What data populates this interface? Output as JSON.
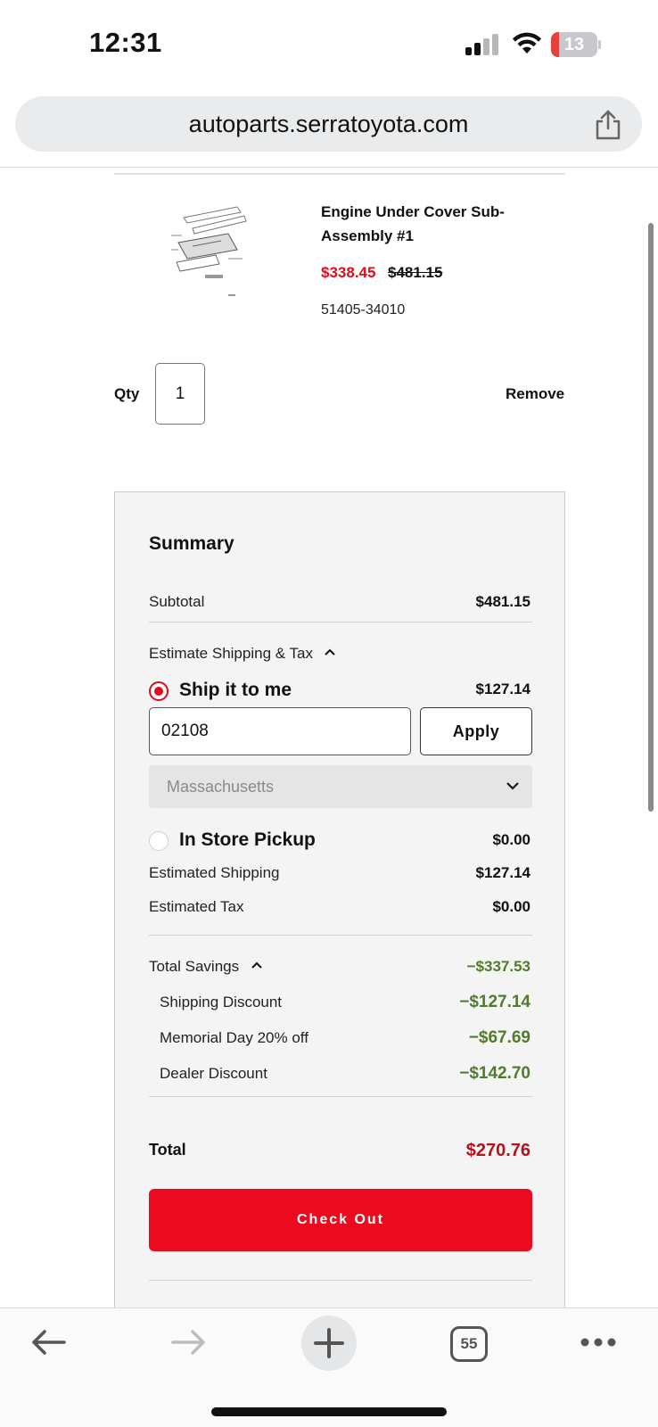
{
  "status_bar": {
    "time": "12:31",
    "battery": "13"
  },
  "browser": {
    "url": "autoparts.serratoyota.com",
    "tab_count": "55"
  },
  "product": {
    "name": "Engine Under Cover Sub-Assembly #1",
    "sale_price": "$338.45",
    "original_price": "$481.15",
    "part_number": "51405-34010",
    "qty_label": "Qty",
    "qty_value": "1",
    "remove_label": "Remove"
  },
  "summary": {
    "title": "Summary",
    "subtotal_label": "Subtotal",
    "subtotal_value": "$481.15",
    "estimate_label": "Estimate Shipping & Tax",
    "ship_option_label": "Ship it to me",
    "ship_option_value": "$127.14",
    "zip_value": "02108",
    "apply_label": "Apply",
    "state_value": "Massachusetts",
    "pickup_label": "In Store Pickup",
    "pickup_value": "$0.00",
    "est_shipping_label": "Estimated Shipping",
    "est_shipping_value": "$127.14",
    "est_tax_label": "Estimated Tax",
    "est_tax_value": "$0.00",
    "savings_label": "Total Savings",
    "savings_value": "−$337.53",
    "discounts": [
      {
        "label": "Shipping Discount",
        "value": "−$127.14"
      },
      {
        "label": "Memorial Day 20% off",
        "value": "−$67.69"
      },
      {
        "label": "Dealer Discount",
        "value": "−$142.70"
      }
    ],
    "total_label": "Total",
    "total_value": "$270.76",
    "checkout_label": "Check Out"
  },
  "icons": [
    "signal-icon",
    "wifi-icon",
    "battery-icon",
    "share-icon",
    "back-arrow-icon",
    "forward-arrow-icon",
    "new-tab-plus-icon",
    "tabs-icon",
    "more-icon",
    "chevron-up-icon",
    "chevron-down-icon"
  ],
  "colors": {
    "accent_red": "#eb0a1e",
    "sale_red": "#e10a1d",
    "savings_green": "#4f7c2a",
    "total_red": "#b5121b"
  }
}
